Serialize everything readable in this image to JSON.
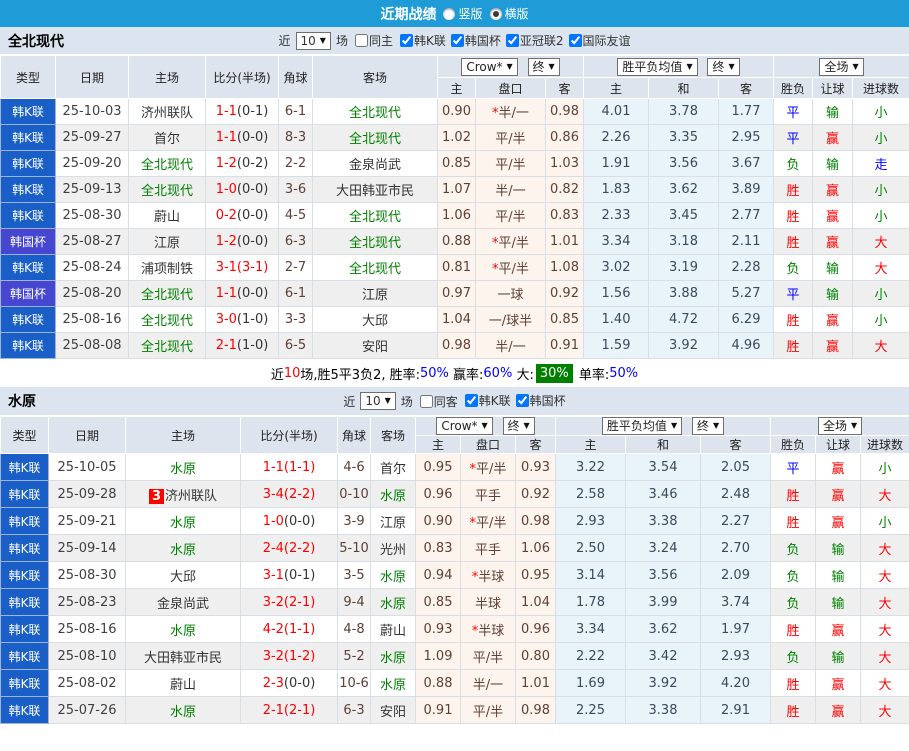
{
  "icons": {
    "chevron_down": "▼"
  },
  "colors": {
    "topbar_bg": "#1F9BD8",
    "league_kl_bg": "#1A5FC8",
    "league_cup_bg": "#4646D0",
    "team_link": "#008000",
    "score_red": "#FF0000",
    "win_red": "#FF0000",
    "lose_green": "#008000",
    "draw_blue": "#0000FF",
    "big_badge_bg": "#008000"
  },
  "topbar": {
    "title": "近期战绩",
    "vertical_label": "竖版",
    "horizontal_label": "横版",
    "selected": "横版"
  },
  "tables": [
    {
      "team": "全北现代",
      "filter": {
        "near_label": "近",
        "count": "10",
        "matches_label": "场",
        "same_label": "同主",
        "same_checked": false,
        "leagues": [
          {
            "label": "韩K联",
            "checked": true
          },
          {
            "label": "韩国杯",
            "checked": true
          },
          {
            "label": "亚冠联2",
            "checked": true
          },
          {
            "label": "国际友谊",
            "checked": true
          }
        ]
      },
      "header": {
        "type": "类型",
        "date": "日期",
        "home": "主场",
        "score": "比分(半场)",
        "corner": "角球",
        "away": "客场",
        "odds_select": "Crow*",
        "final_select": "终",
        "avg_select": "胜平负均值",
        "final_select2": "终",
        "scope_select": "全场",
        "sub": [
          "主",
          "盘口",
          "客",
          "主",
          "和",
          "客",
          "胜负",
          "让球",
          "进球数"
        ]
      },
      "rows": [
        {
          "league": "韩K联",
          "lclass": "kl",
          "date": "25-10-03",
          "home": "济州联队",
          "home_link": false,
          "card": "",
          "ft": "1-1",
          "half": "(0-1)",
          "half_red": false,
          "corner": "6-1",
          "away": "全北现代",
          "away_link": true,
          "odds": [
            "0.90",
            "*半/一",
            "0.98"
          ],
          "avg": [
            "4.01",
            "3.78",
            "1.77"
          ],
          "res": [
            [
              "平",
              "blue"
            ],
            [
              "输",
              "green"
            ],
            [
              "小",
              "green"
            ]
          ]
        },
        {
          "league": "韩K联",
          "lclass": "kl",
          "date": "25-09-27",
          "home": "首尔",
          "home_link": false,
          "card": "",
          "ft": "1-1",
          "half": "(0-0)",
          "half_red": false,
          "corner": "8-3",
          "away": "全北现代",
          "away_link": true,
          "odds": [
            "1.02",
            "平/半",
            "0.86"
          ],
          "avg": [
            "2.26",
            "3.35",
            "2.95"
          ],
          "res": [
            [
              "平",
              "blue"
            ],
            [
              "赢",
              "red"
            ],
            [
              "小",
              "green"
            ]
          ]
        },
        {
          "league": "韩K联",
          "lclass": "kl",
          "date": "25-09-20",
          "home": "全北现代",
          "home_link": true,
          "card": "",
          "ft": "1-2",
          "half": "(0-2)",
          "half_red": false,
          "corner": "2-2",
          "away": "金泉尚武",
          "away_link": false,
          "odds": [
            "0.85",
            "平/半",
            "1.03"
          ],
          "avg": [
            "1.91",
            "3.56",
            "3.67"
          ],
          "res": [
            [
              "负",
              "green"
            ],
            [
              "输",
              "green"
            ],
            [
              "走",
              "blue"
            ]
          ]
        },
        {
          "league": "韩K联",
          "lclass": "kl",
          "date": "25-09-13",
          "home": "全北现代",
          "home_link": true,
          "card": "",
          "ft": "1-0",
          "half": "(0-0)",
          "half_red": false,
          "corner": "3-6",
          "away": "大田韩亚市民",
          "away_link": false,
          "odds": [
            "1.07",
            "半/一",
            "0.82"
          ],
          "avg": [
            "1.83",
            "3.62",
            "3.89"
          ],
          "res": [
            [
              "胜",
              "red"
            ],
            [
              "赢",
              "red"
            ],
            [
              "小",
              "green"
            ]
          ]
        },
        {
          "league": "韩K联",
          "lclass": "kl",
          "date": "25-08-30",
          "home": "蔚山",
          "home_link": false,
          "card": "",
          "ft": "0-2",
          "half": "(0-0)",
          "half_red": false,
          "corner": "4-5",
          "away": "全北现代",
          "away_link": true,
          "odds": [
            "1.06",
            "平/半",
            "0.83"
          ],
          "avg": [
            "2.33",
            "3.45",
            "2.77"
          ],
          "res": [
            [
              "胜",
              "red"
            ],
            [
              "赢",
              "red"
            ],
            [
              "小",
              "green"
            ]
          ]
        },
        {
          "league": "韩国杯",
          "lclass": "cup",
          "date": "25-08-27",
          "home": "江原",
          "home_link": false,
          "card": "",
          "ft": "1-2",
          "half": "(0-0)",
          "half_red": false,
          "corner": "6-3",
          "away": "全北现代",
          "away_link": true,
          "odds": [
            "0.88",
            "*平/半",
            "1.01"
          ],
          "avg": [
            "3.34",
            "3.18",
            "2.11"
          ],
          "res": [
            [
              "胜",
              "red"
            ],
            [
              "赢",
              "red"
            ],
            [
              "大",
              "red"
            ]
          ]
        },
        {
          "league": "韩K联",
          "lclass": "kl",
          "date": "25-08-24",
          "home": "浦项制铁",
          "home_link": false,
          "card": "",
          "ft": "3-1",
          "half": "(3-1)",
          "half_red": true,
          "corner": "2-7",
          "away": "全北现代",
          "away_link": true,
          "odds": [
            "0.81",
            "*平/半",
            "1.08"
          ],
          "avg": [
            "3.02",
            "3.19",
            "2.28"
          ],
          "res": [
            [
              "负",
              "green"
            ],
            [
              "输",
              "green"
            ],
            [
              "大",
              "red"
            ]
          ]
        },
        {
          "league": "韩国杯",
          "lclass": "cup",
          "date": "25-08-20",
          "home": "全北现代",
          "home_link": true,
          "card": "",
          "ft": "1-1",
          "half": "(0-0)",
          "half_red": false,
          "corner": "6-1",
          "away": "江原",
          "away_link": false,
          "odds": [
            "0.97",
            "一球",
            "0.92"
          ],
          "avg": [
            "1.56",
            "3.88",
            "5.27"
          ],
          "res": [
            [
              "平",
              "blue"
            ],
            [
              "输",
              "green"
            ],
            [
              "小",
              "green"
            ]
          ]
        },
        {
          "league": "韩K联",
          "lclass": "kl",
          "date": "25-08-16",
          "home": "全北现代",
          "home_link": true,
          "card": "",
          "ft": "3-0",
          "half": "(1-0)",
          "half_red": false,
          "corner": "3-3",
          "away": "大邱",
          "away_link": false,
          "odds": [
            "1.04",
            "一/球半",
            "0.85"
          ],
          "avg": [
            "1.40",
            "4.72",
            "6.29"
          ],
          "res": [
            [
              "胜",
              "red"
            ],
            [
              "赢",
              "red"
            ],
            [
              "小",
              "green"
            ]
          ]
        },
        {
          "league": "韩K联",
          "lclass": "kl",
          "date": "25-08-08",
          "home": "全北现代",
          "home_link": true,
          "card": "",
          "ft": "2-1",
          "half": "(1-0)",
          "half_red": false,
          "corner": "6-5",
          "away": "安阳",
          "away_link": false,
          "odds": [
            "0.98",
            "半/一",
            "0.91"
          ],
          "avg": [
            "1.59",
            "3.92",
            "4.96"
          ],
          "res": [
            [
              "胜",
              "red"
            ],
            [
              "赢",
              "red"
            ],
            [
              "大",
              "red"
            ]
          ]
        }
      ],
      "summary": [
        {
          "text": "近",
          "style": "plain"
        },
        {
          "text": "10",
          "style": "red"
        },
        {
          "text": "场,胜5平3负2, 胜率:",
          "style": "plain"
        },
        {
          "text": "50%",
          "style": "blue"
        },
        {
          "text": " 赢率:",
          "style": "plain"
        },
        {
          "text": "60%",
          "style": "blue"
        },
        {
          "text": " 大:",
          "style": "plain"
        },
        {
          "text": "30%",
          "style": "greenbadge"
        },
        {
          "text": " 单率:",
          "style": "plain"
        },
        {
          "text": "50%",
          "style": "blue"
        }
      ]
    },
    {
      "team": "水原",
      "filter": {
        "near_label": "近",
        "count": "10",
        "matches_label": "场",
        "same_label": "同客",
        "same_checked": false,
        "leagues": [
          {
            "label": "韩K联",
            "checked": true
          },
          {
            "label": "韩国杯",
            "checked": true
          }
        ]
      },
      "header": {
        "type": "类型",
        "date": "日期",
        "home": "主场",
        "score": "比分(半场)",
        "corner": "角球",
        "away": "客场",
        "odds_select": "Crow*",
        "final_select": "终",
        "avg_select": "胜平负均值",
        "final_select2": "终",
        "scope_select": "全场",
        "sub": [
          "主",
          "盘口",
          "客",
          "主",
          "和",
          "客",
          "胜负",
          "让球",
          "进球数"
        ]
      },
      "rows": [
        {
          "league": "韩K联",
          "lclass": "kl",
          "date": "25-10-05",
          "home": "水原",
          "home_link": true,
          "card": "",
          "ft": "1-1",
          "half": "(1-1)",
          "half_red": true,
          "corner": "4-6",
          "away": "首尔",
          "away_link": false,
          "odds": [
            "0.95",
            "*平/半",
            "0.93"
          ],
          "avg": [
            "3.22",
            "3.54",
            "2.05"
          ],
          "res": [
            [
              "平",
              "blue"
            ],
            [
              "赢",
              "red"
            ],
            [
              "小",
              "green"
            ]
          ]
        },
        {
          "league": "韩K联",
          "lclass": "kl",
          "date": "25-09-28",
          "home": "济州联队",
          "home_link": false,
          "card": "3",
          "ft": "3-4",
          "half": "(2-2)",
          "half_red": true,
          "corner": "0-10",
          "away": "水原",
          "away_link": true,
          "odds": [
            "0.96",
            "平手",
            "0.92"
          ],
          "avg": [
            "2.58",
            "3.46",
            "2.48"
          ],
          "res": [
            [
              "胜",
              "red"
            ],
            [
              "赢",
              "red"
            ],
            [
              "大",
              "red"
            ]
          ]
        },
        {
          "league": "韩K联",
          "lclass": "kl",
          "date": "25-09-21",
          "home": "水原",
          "home_link": true,
          "card": "",
          "ft": "1-0",
          "half": "(0-0)",
          "half_red": false,
          "corner": "3-9",
          "away": "江原",
          "away_link": false,
          "odds": [
            "0.90",
            "*平/半",
            "0.98"
          ],
          "avg": [
            "2.93",
            "3.38",
            "2.27"
          ],
          "res": [
            [
              "胜",
              "red"
            ],
            [
              "赢",
              "red"
            ],
            [
              "小",
              "green"
            ]
          ]
        },
        {
          "league": "韩K联",
          "lclass": "kl",
          "date": "25-09-14",
          "home": "水原",
          "home_link": true,
          "card": "",
          "ft": "2-4",
          "half": "(2-2)",
          "half_red": true,
          "corner": "5-10",
          "away": "光州",
          "away_link": false,
          "odds": [
            "0.83",
            "平手",
            "1.06"
          ],
          "avg": [
            "2.50",
            "3.24",
            "2.70"
          ],
          "res": [
            [
              "负",
              "green"
            ],
            [
              "输",
              "green"
            ],
            [
              "大",
              "red"
            ]
          ]
        },
        {
          "league": "韩K联",
          "lclass": "kl",
          "date": "25-08-30",
          "home": "大邱",
          "home_link": false,
          "card": "",
          "ft": "3-1",
          "half": "(0-1)",
          "half_red": false,
          "corner": "3-5",
          "away": "水原",
          "away_link": true,
          "odds": [
            "0.94",
            "*半球",
            "0.95"
          ],
          "avg": [
            "3.14",
            "3.56",
            "2.09"
          ],
          "res": [
            [
              "负",
              "green"
            ],
            [
              "输",
              "green"
            ],
            [
              "大",
              "red"
            ]
          ]
        },
        {
          "league": "韩K联",
          "lclass": "kl",
          "date": "25-08-23",
          "home": "金泉尚武",
          "home_link": false,
          "card": "",
          "ft": "3-2",
          "half": "(2-1)",
          "half_red": true,
          "corner": "9-4",
          "away": "水原",
          "away_link": true,
          "odds": [
            "0.85",
            "半球",
            "1.04"
          ],
          "avg": [
            "1.78",
            "3.99",
            "3.74"
          ],
          "res": [
            [
              "负",
              "green"
            ],
            [
              "输",
              "green"
            ],
            [
              "大",
              "red"
            ]
          ]
        },
        {
          "league": "韩K联",
          "lclass": "kl",
          "date": "25-08-16",
          "home": "水原",
          "home_link": true,
          "card": "",
          "ft": "4-2",
          "half": "(1-1)",
          "half_red": true,
          "corner": "4-8",
          "away": "蔚山",
          "away_link": false,
          "odds": [
            "0.93",
            "*半球",
            "0.96"
          ],
          "avg": [
            "3.34",
            "3.62",
            "1.97"
          ],
          "res": [
            [
              "胜",
              "red"
            ],
            [
              "赢",
              "red"
            ],
            [
              "大",
              "red"
            ]
          ]
        },
        {
          "league": "韩K联",
          "lclass": "kl",
          "date": "25-08-10",
          "home": "大田韩亚市民",
          "home_link": false,
          "card": "",
          "ft": "3-2",
          "half": "(1-2)",
          "half_red": true,
          "corner": "5-2",
          "away": "水原",
          "away_link": true,
          "odds": [
            "1.09",
            "平/半",
            "0.80"
          ],
          "avg": [
            "2.22",
            "3.42",
            "2.93"
          ],
          "res": [
            [
              "负",
              "green"
            ],
            [
              "输",
              "green"
            ],
            [
              "大",
              "red"
            ]
          ]
        },
        {
          "league": "韩K联",
          "lclass": "kl",
          "date": "25-08-02",
          "home": "蔚山",
          "home_link": false,
          "card": "",
          "ft": "2-3",
          "half": "(0-0)",
          "half_red": false,
          "corner": "10-6",
          "away": "水原",
          "away_link": true,
          "odds": [
            "0.88",
            "半/一",
            "1.01"
          ],
          "avg": [
            "1.69",
            "3.92",
            "4.20"
          ],
          "res": [
            [
              "胜",
              "red"
            ],
            [
              "赢",
              "red"
            ],
            [
              "大",
              "red"
            ]
          ]
        },
        {
          "league": "韩K联",
          "lclass": "kl",
          "date": "25-07-26",
          "home": "水原",
          "home_link": true,
          "card": "",
          "ft": "2-1",
          "half": "(2-1)",
          "half_red": true,
          "corner": "6-3",
          "away": "安阳",
          "away_link": false,
          "odds": [
            "0.91",
            "平/半",
            "0.98"
          ],
          "avg": [
            "2.25",
            "3.38",
            "2.91"
          ],
          "res": [
            [
              "胜",
              "red"
            ],
            [
              "赢",
              "red"
            ],
            [
              "大",
              "red"
            ]
          ]
        }
      ],
      "summary": []
    }
  ]
}
